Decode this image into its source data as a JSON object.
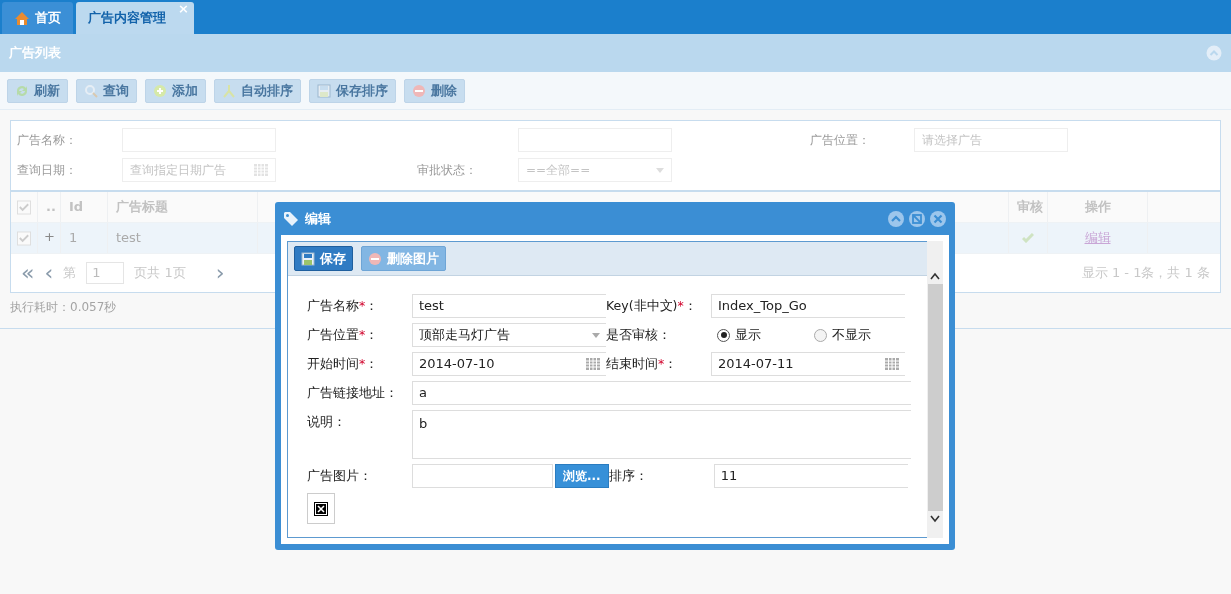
{
  "tabs": [
    {
      "label": "首页",
      "selected": false,
      "kind": "home"
    },
    {
      "label": "广告内容管理",
      "selected": true,
      "close": "×"
    }
  ],
  "panel": {
    "title": "广告列表"
  },
  "toolbar": [
    {
      "label": "刷新"
    },
    {
      "label": "查询"
    },
    {
      "label": "添加"
    },
    {
      "label": "自动排序"
    },
    {
      "label": "保存排序"
    },
    {
      "label": "删除"
    }
  ],
  "search": {
    "rows": [
      [
        {
          "label": "广告名称：",
          "kind": "text"
        },
        {
          "kind": "text"
        },
        {
          "label": "广告位置：",
          "kind": "text",
          "placeholder": "请选择广告"
        }
      ],
      [
        {
          "label": "查询日期：",
          "kind": "date",
          "placeholder": "查询指定日期广告"
        },
        {
          "label": "审批状态：",
          "kind": "select",
          "value": "==全部=="
        }
      ]
    ]
  },
  "grid": {
    "columns": [
      "",
      "..",
      "Id",
      "广告标题",
      "",
      "审核",
      "操作"
    ],
    "header_checked": true,
    "rows": [
      {
        "selected": true,
        "checked": true,
        "expand": "+",
        "id": "1",
        "title": "test",
        "audited": true,
        "action": "编辑"
      }
    ],
    "pager": {
      "first": "«",
      "prev": "‹",
      "page_prefix": "第",
      "page": "1",
      "page_suffix": "页共 1页",
      "next": "›",
      "info": "显示 1 - 1条，共 1 条"
    }
  },
  "status": "执行耗时：0.057秒",
  "dialog": {
    "title": "编辑",
    "buttons": [
      {
        "label": "保存",
        "primary": true
      },
      {
        "label": "删除图片",
        "primary": false
      }
    ],
    "rows": [
      [
        {
          "label": "广告名称",
          "mark": "*",
          "colon": "：",
          "kind": "text",
          "value": "test"
        },
        {
          "label": "Key(非中文)",
          "mark": "*",
          "colon": "：",
          "kind": "text",
          "value": "Index_Top_Go"
        }
      ],
      [
        {
          "label": "广告位置",
          "mark": "*",
          "colon": "：",
          "kind": "select",
          "value": "顶部走马灯广告"
        },
        {
          "label": "是否审核：",
          "kind": "radio",
          "options": [
            {
              "label": "显示",
              "selected": true
            },
            {
              "label": "不显示",
              "selected": false
            }
          ]
        }
      ],
      [
        {
          "label": "开始时间",
          "mark": "*",
          "colon": "：",
          "kind": "date",
          "value": "2014-07-10"
        },
        {
          "label": "结束时间",
          "mark": "*",
          "colon": "：",
          "kind": "date",
          "value": "2014-07-11"
        }
      ],
      [
        {
          "label": "广告链接地址：",
          "kind": "wide",
          "value": "a"
        }
      ],
      [
        {
          "label": "说明：",
          "kind": "textarea",
          "value": "b"
        }
      ],
      [
        {
          "label": "广告图片：",
          "kind": "file",
          "button": "浏览..."
        },
        {
          "label": "排序：",
          "kind": "text",
          "value": "11"
        }
      ]
    ]
  }
}
